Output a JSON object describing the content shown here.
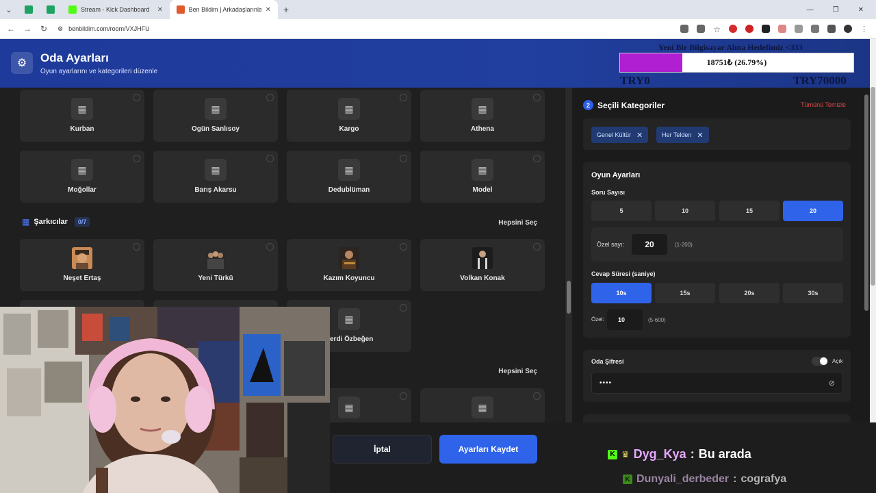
{
  "browser": {
    "tabs": [
      {
        "label": "",
        "color": "#1ea362"
      },
      {
        "label": "",
        "color": "#1ea362"
      },
      {
        "label": "Stream - Kick Dashboard",
        "color": "#53fc18"
      },
      {
        "label": "Ben Bildim | Arkadaşlarınla Onl",
        "color": "#e05a2b"
      }
    ],
    "url": "benbildim.com/room/VXJHFU"
  },
  "header": {
    "title": "Oda Ayarları",
    "subtitle": "Oyun ayarlarını ve kategorileri düzenle"
  },
  "goal": {
    "title": "Yeni Bir Bilgisayar Alma Hedefimiz <333",
    "progress_text": "18751₺ (26.79%)",
    "progress_fraction": 0.2679,
    "min_label": "TRY0",
    "max_label": "TRY70000",
    "fill_color": "#b01fd1"
  },
  "left": {
    "row1": [
      "Kurban",
      "Ogün Sanlısoy",
      "Kargo",
      "Athena"
    ],
    "row2": [
      "Moğollar",
      "Barış Akarsu",
      "Dedublüman",
      "Model"
    ],
    "section_singers": {
      "title": "Şarkıcılar",
      "count": "0/7",
      "select_all": "Hepsini Seç"
    },
    "row3": [
      "Neşet Ertaş",
      "Yeni Türkü",
      "Kazım Koyuncu",
      "Volkan Konak"
    ],
    "row4_partial": "erdi Özbeğen",
    "select_all_2": "Hepsini Seç"
  },
  "right": {
    "selected_title": "Seçili Kategoriler",
    "selected_num": "2",
    "clear_all": "Tümünü Temizle",
    "chips": [
      "Genel Kültür",
      "Her Telden"
    ],
    "game_settings_title": "Oyun Ayarları",
    "question_count_label": "Soru Sayısı",
    "question_options": [
      "5",
      "10",
      "15",
      "20"
    ],
    "question_selected": "20",
    "custom_count_label": "Özel sayı:",
    "custom_count_value": "20",
    "custom_count_range": "(1-200)",
    "answer_time_label": "Cevap Süresi (saniye)",
    "time_options": [
      "10s",
      "15s",
      "20s",
      "30s"
    ],
    "time_selected": "10s",
    "custom_time_label": "Özel:",
    "custom_time_value": "10",
    "custom_time_range": "(5-600)",
    "room_password_label": "Oda Şifresi",
    "toggle_label": "Açık",
    "password_value": "••••"
  },
  "footer": {
    "cancel": "İptal",
    "save": "Ayarları Kaydet"
  },
  "chat": [
    {
      "user": "Dyg_Kya",
      "sep": ":",
      "message": "Bu arada"
    },
    {
      "user": "Dunyali_derbeder",
      "sep": ":",
      "message": "cografya"
    }
  ]
}
